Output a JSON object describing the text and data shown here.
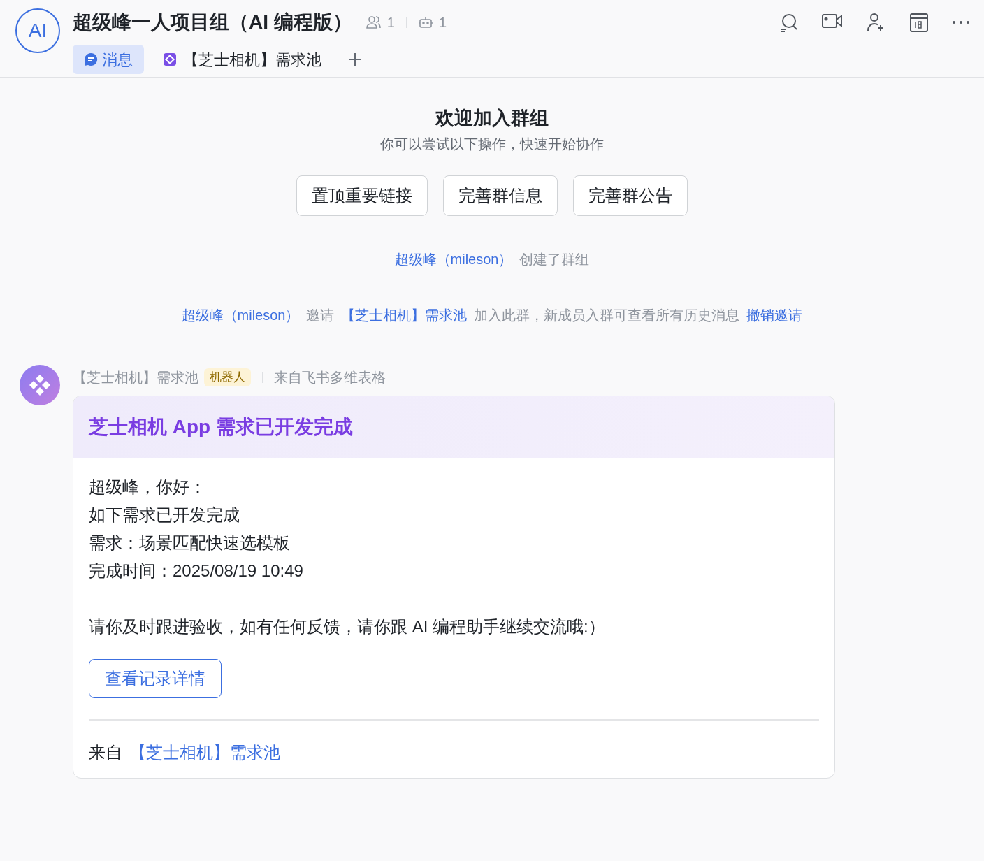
{
  "header": {
    "avatar_text": "AI",
    "title": "超级峰一人项目组（AI 编程版）",
    "member_count": "1",
    "bot_count": "1",
    "tabs": [
      {
        "label": "消息",
        "kind": "chat",
        "selected": true
      },
      {
        "label": "【芝士相机】需求池",
        "kind": "app",
        "selected": false
      }
    ]
  },
  "welcome": {
    "title": "欢迎加入群组",
    "subtitle": "你可以尝试以下操作，快速开始协作",
    "actions": [
      "置顶重要链接",
      "完善群信息",
      "完善群公告"
    ]
  },
  "system_messages": [
    [
      {
        "text": "超级峰（mileson）",
        "kind": "link"
      },
      {
        "text": "创建了群组",
        "kind": "plain"
      }
    ],
    [
      {
        "text": "超级峰（mileson）",
        "kind": "link"
      },
      {
        "text": "邀请",
        "kind": "plain"
      },
      {
        "text": "【芝士相机】需求池",
        "kind": "link"
      },
      {
        "text": "加入此群，新成员入群可查看所有历史消息",
        "kind": "plain"
      },
      {
        "text": "撤销邀请",
        "kind": "action"
      }
    ]
  ],
  "message": {
    "sender": "【芝士相机】需求池",
    "badge": "机器人",
    "source": "来自飞书多维表格",
    "card": {
      "title": "芝士相机 App 需求已开发完成",
      "paragraphs": [
        [
          "超级峰，你好：",
          "如下需求已开发完成",
          "需求：场景匹配快速选模板",
          "完成时间：2025/08/19 10:49"
        ],
        [
          "请你及时跟进验收，如有任何反馈，请你跟 AI 编程助手继续交流哦:）"
        ]
      ],
      "button": "查看记录详情",
      "footer_label": "来自",
      "footer_link": "【芝士相机】需求池"
    }
  }
}
